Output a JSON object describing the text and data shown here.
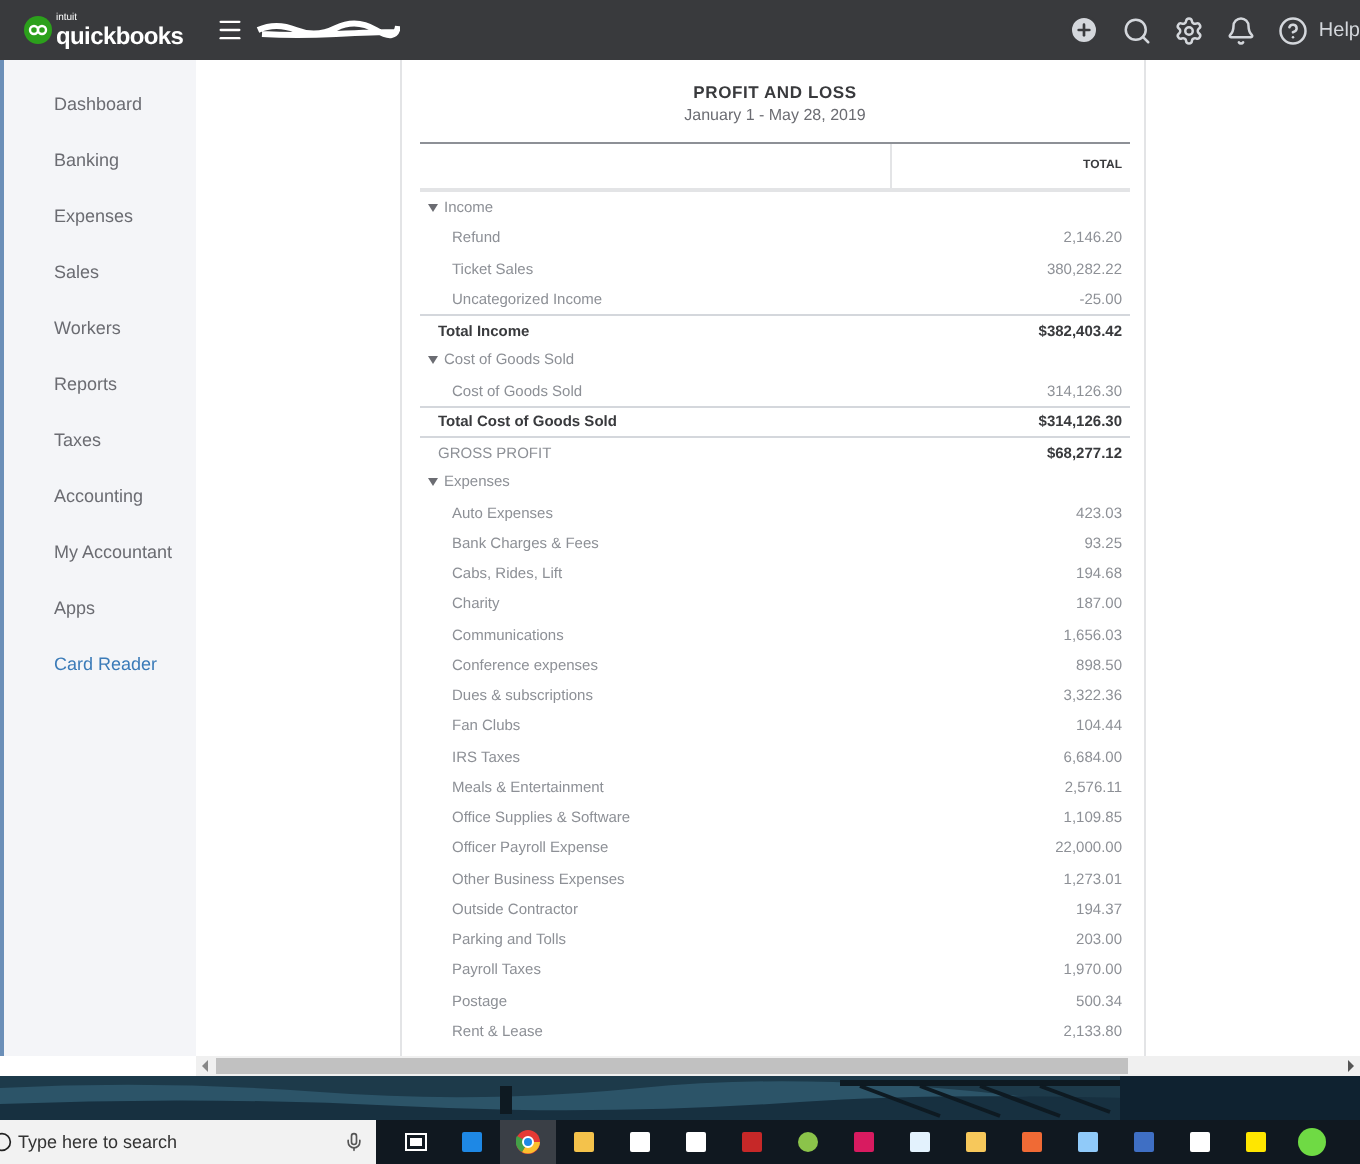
{
  "topbar": {
    "logo_small": "intuit",
    "logo": "quickbooks",
    "help": "Help"
  },
  "sidebar": {
    "items": [
      {
        "label": "Dashboard",
        "kind": "nav"
      },
      {
        "label": "Banking",
        "kind": "nav"
      },
      {
        "label": "Expenses",
        "kind": "nav"
      },
      {
        "label": "Sales",
        "kind": "nav"
      },
      {
        "label": "Workers",
        "kind": "nav"
      },
      {
        "label": "Reports",
        "kind": "nav"
      },
      {
        "label": "Taxes",
        "kind": "nav"
      },
      {
        "label": "Accounting",
        "kind": "nav"
      },
      {
        "label": "My Accountant",
        "kind": "nav"
      },
      {
        "label": "Apps",
        "kind": "nav"
      },
      {
        "label": "Card Reader",
        "kind": "link"
      }
    ]
  },
  "report": {
    "title": "PROFIT AND LOSS",
    "period": "January 1 - May 28, 2019",
    "columns": [
      "TOTAL"
    ],
    "rows": [
      {
        "kind": "section",
        "label": "Income",
        "expanded": true
      },
      {
        "kind": "item",
        "label": "Refund",
        "value": "2,146.20"
      },
      {
        "kind": "item",
        "label": "Ticket Sales",
        "value": "380,282.22"
      },
      {
        "kind": "item",
        "label": "Uncategorized Income",
        "value": "-25.00"
      },
      {
        "kind": "total",
        "label": "Total Income",
        "value": "$382,403.42"
      },
      {
        "kind": "section",
        "label": "Cost of Goods Sold",
        "expanded": true
      },
      {
        "kind": "item",
        "label": "Cost of Goods Sold",
        "value": "314,126.30"
      },
      {
        "kind": "total",
        "label": "Total Cost of Goods Sold",
        "value": "$314,126.30"
      },
      {
        "kind": "gross",
        "label": "GROSS PROFIT",
        "value": "$68,277.12"
      },
      {
        "kind": "section",
        "label": "Expenses",
        "expanded": true
      },
      {
        "kind": "item",
        "label": "Auto Expenses",
        "value": "423.03"
      },
      {
        "kind": "item",
        "label": "Bank Charges & Fees",
        "value": "93.25"
      },
      {
        "kind": "item",
        "label": "Cabs, Rides, Lift",
        "value": "194.68"
      },
      {
        "kind": "item",
        "label": "Charity",
        "value": "187.00"
      },
      {
        "kind": "item",
        "label": "Communications",
        "value": "1,656.03"
      },
      {
        "kind": "item",
        "label": "Conference expenses",
        "value": "898.50"
      },
      {
        "kind": "item",
        "label": "Dues & subscriptions",
        "value": "3,322.36"
      },
      {
        "kind": "item",
        "label": "Fan Clubs",
        "value": "104.44"
      },
      {
        "kind": "item",
        "label": "IRS Taxes",
        "value": "6,684.00"
      },
      {
        "kind": "item",
        "label": "Meals & Entertainment",
        "value": "2,576.11"
      },
      {
        "kind": "item",
        "label": "Office Supplies & Software",
        "value": "1,109.85"
      },
      {
        "kind": "item",
        "label": "Officer Payroll Expense",
        "value": "22,000.00"
      },
      {
        "kind": "item",
        "label": "Other Business Expenses",
        "value": "1,273.01"
      },
      {
        "kind": "item",
        "label": "Outside Contractor",
        "value": "194.37"
      },
      {
        "kind": "item",
        "label": "Parking and Tolls",
        "value": "203.00"
      },
      {
        "kind": "item",
        "label": "Payroll Taxes",
        "value": "1,970.00"
      },
      {
        "kind": "item",
        "label": "Postage",
        "value": "500.34"
      },
      {
        "kind": "item",
        "label": "Rent & Lease",
        "value": "2,133.80"
      }
    ]
  },
  "taskbar": {
    "search": {
      "placeholder": "Type here to search"
    },
    "apps": [
      {
        "selected": false
      },
      {
        "selected": false
      },
      {
        "selected": true
      },
      {
        "selected": false
      },
      {
        "selected": false
      },
      {
        "selected": false
      },
      {
        "selected": false
      },
      {
        "selected": false
      },
      {
        "selected": false
      },
      {
        "selected": false
      },
      {
        "selected": false
      },
      {
        "selected": false
      },
      {
        "selected": false
      },
      {
        "selected": false
      },
      {
        "selected": false
      },
      {
        "selected": false
      }
    ]
  }
}
